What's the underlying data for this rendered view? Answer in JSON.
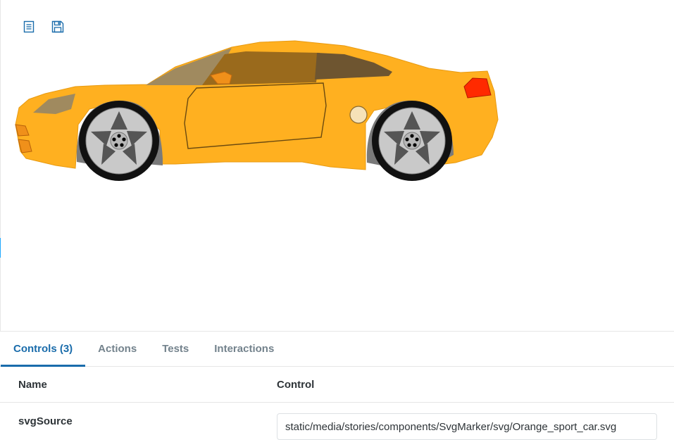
{
  "preview": {
    "toolbar": [
      {
        "icon": "list-icon",
        "color": "#1a6cab"
      },
      {
        "icon": "save-icon",
        "color": "#1a6cab"
      }
    ],
    "image": {
      "subject": "orange-sports-car",
      "body_color": "#ffb020"
    }
  },
  "addons": {
    "tabs": [
      {
        "label": "Controls (3)",
        "active": true
      },
      {
        "label": "Actions",
        "active": false
      },
      {
        "label": "Tests",
        "active": false
      },
      {
        "label": "Interactions",
        "active": false
      }
    ],
    "table": {
      "headers": {
        "name": "Name",
        "control": "Control"
      },
      "rows": [
        {
          "name": "svgSource",
          "value": "static/media/stories/components/SvgMarker/svg/Orange_sport_car.svg"
        }
      ]
    }
  },
  "colors": {
    "accent": "#1a6cab",
    "tab_inactive": "#73828c",
    "border": "#e6e6e6"
  }
}
